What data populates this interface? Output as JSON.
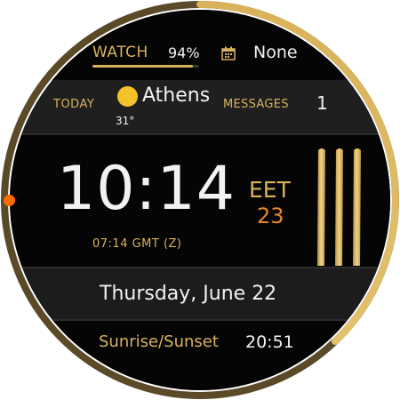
{
  "status": {
    "watch_label": "WATCH",
    "battery_percent": "94%",
    "battery_level": 0.94,
    "calendar_icon": "calendar-icon",
    "calendar_event": "None"
  },
  "weather": {
    "today_label": "TODAY",
    "icon": "sun-icon",
    "city": "Athens",
    "temperature": "31°"
  },
  "messages": {
    "label": "MESSAGES",
    "count": "1"
  },
  "clock": {
    "time": "10:14",
    "secondary_time": "07:14 GMT (Z)",
    "timezone": "EET",
    "timezone_number": "23",
    "decorative_bars": "striped-bars-icon"
  },
  "date": {
    "text": "Thursday, June 22"
  },
  "sun": {
    "label": "Sunrise/Sunset",
    "time": "20:51"
  },
  "colors": {
    "accent_gold": "#d9b25a",
    "sun_yellow": "#f5c12b",
    "accent_orange": "#e8872a",
    "background": "#050505"
  }
}
